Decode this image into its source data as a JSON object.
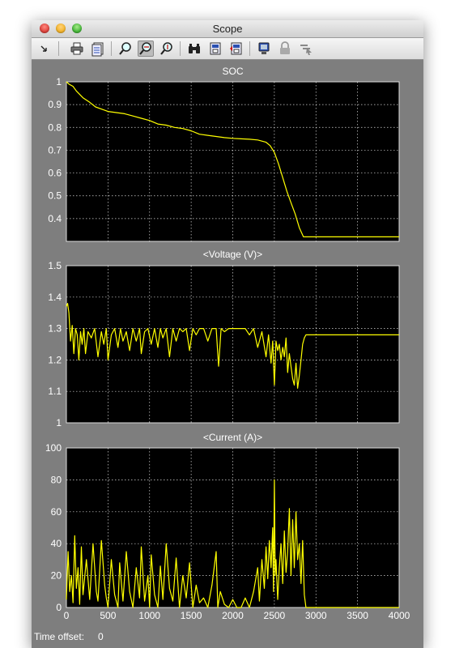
{
  "window": {
    "title": "Scope"
  },
  "toolbar": {
    "icons": [
      "arrow-icon",
      "print-icon",
      "params-icon",
      "zoom-icon",
      "zoom-x-icon",
      "zoom-y-icon",
      "binoculars-icon",
      "save-axes-icon",
      "restore-axes-icon",
      "float-icon",
      "lock-icon",
      "select-signals-icon"
    ]
  },
  "status": {
    "label": "Time offset:",
    "value": "0"
  },
  "colors": {
    "background": "#7e7e7e",
    "axes": "#000000",
    "trace": "#ffff00",
    "grid": "#ffffff"
  },
  "chart_data": [
    {
      "type": "line",
      "title": "SOC",
      "xlim": [
        0,
        4000
      ],
      "ylim": [
        0.3,
        1.0
      ],
      "yticks": [
        "0.4",
        "0.5",
        "0.6",
        "0.7",
        "0.8",
        "0.9",
        "1"
      ],
      "ytick_values": [
        0.4,
        0.5,
        0.6,
        0.7,
        0.8,
        0.9,
        1.0
      ],
      "grid": true,
      "series": [
        {
          "x": [
            0,
            30,
            80,
            120,
            200,
            280,
            350,
            500,
            600,
            700,
            800,
            900,
            1000,
            1100,
            1200,
            1300,
            1400,
            1500,
            1600,
            1700,
            1800,
            1900,
            2000,
            2100,
            2200,
            2300,
            2400,
            2450,
            2500,
            2550,
            2600,
            2650,
            2700,
            2750,
            2800,
            2850,
            3000,
            3500,
            4000
          ],
          "y": [
            1.0,
            0.99,
            0.98,
            0.96,
            0.93,
            0.91,
            0.89,
            0.87,
            0.865,
            0.86,
            0.85,
            0.84,
            0.83,
            0.815,
            0.81,
            0.8,
            0.795,
            0.785,
            0.77,
            0.765,
            0.76,
            0.755,
            0.752,
            0.75,
            0.748,
            0.745,
            0.735,
            0.72,
            0.69,
            0.64,
            0.58,
            0.52,
            0.47,
            0.42,
            0.36,
            0.32,
            0.32,
            0.32,
            0.32
          ]
        }
      ]
    },
    {
      "type": "line",
      "title": "<Voltage (V)>",
      "xlim": [
        0,
        4000
      ],
      "ylim": [
        1.0,
        1.5
      ],
      "yticks": [
        "1",
        "1.1",
        "1.2",
        "1.3",
        "1.4",
        "1.5"
      ],
      "ytick_values": [
        1.0,
        1.1,
        1.2,
        1.3,
        1.4,
        1.5
      ],
      "grid": true,
      "series": [
        {
          "x": [
            0,
            15,
            30,
            50,
            70,
            90,
            110,
            130,
            150,
            170,
            190,
            210,
            230,
            260,
            300,
            340,
            380,
            420,
            450,
            480,
            500,
            540,
            580,
            620,
            650,
            680,
            720,
            760,
            800,
            840,
            880,
            900,
            940,
            980,
            1020,
            1060,
            1100,
            1130,
            1160,
            1200,
            1240,
            1280,
            1320,
            1360,
            1400,
            1440,
            1480,
            1520,
            1560,
            1600,
            1650,
            1700,
            1750,
            1800,
            1830,
            1860,
            1900,
            1950,
            2000,
            2050,
            2100,
            2150,
            2200,
            2250,
            2300,
            2350,
            2400,
            2430,
            2460,
            2480,
            2500,
            2520,
            2540,
            2560,
            2580,
            2600,
            2620,
            2640,
            2660,
            2680,
            2700,
            2720,
            2740,
            2760,
            2780,
            2800,
            2820,
            2840,
            2860,
            2880,
            2900,
            3000,
            3500,
            4000
          ],
          "y": [
            1.37,
            1.38,
            1.35,
            1.26,
            1.31,
            1.22,
            1.3,
            1.28,
            1.2,
            1.29,
            1.25,
            1.3,
            1.22,
            1.29,
            1.27,
            1.3,
            1.21,
            1.29,
            1.25,
            1.3,
            1.2,
            1.28,
            1.3,
            1.24,
            1.3,
            1.26,
            1.29,
            1.23,
            1.3,
            1.26,
            1.3,
            1.22,
            1.29,
            1.3,
            1.25,
            1.3,
            1.24,
            1.3,
            1.27,
            1.3,
            1.21,
            1.3,
            1.26,
            1.3,
            1.29,
            1.3,
            1.23,
            1.3,
            1.28,
            1.3,
            1.3,
            1.26,
            1.3,
            1.3,
            1.18,
            1.3,
            1.29,
            1.3,
            1.3,
            1.3,
            1.3,
            1.3,
            1.28,
            1.3,
            1.24,
            1.29,
            1.21,
            1.28,
            1.19,
            1.26,
            1.12,
            1.26,
            1.23,
            1.25,
            1.2,
            1.24,
            1.21,
            1.27,
            1.16,
            1.22,
            1.18,
            1.14,
            1.12,
            1.19,
            1.11,
            1.15,
            1.2,
            1.25,
            1.27,
            1.28,
            1.28,
            1.28,
            1.28,
            1.28
          ]
        }
      ]
    },
    {
      "type": "line",
      "title": "<Current (A)>",
      "xlim": [
        0,
        4000
      ],
      "ylim": [
        0,
        100
      ],
      "yticks": [
        "0",
        "20",
        "40",
        "60",
        "80",
        "100"
      ],
      "ytick_values": [
        0,
        20,
        40,
        60,
        80,
        100
      ],
      "xticks": [
        "0",
        "500",
        "1000",
        "1500",
        "2000",
        "2500",
        "3000",
        "3500",
        "4000"
      ],
      "xtick_values": [
        0,
        500,
        1000,
        1500,
        2000,
        2500,
        3000,
        3500,
        4000
      ],
      "grid": true,
      "series": [
        {
          "x": [
            0,
            20,
            40,
            60,
            80,
            100,
            120,
            140,
            160,
            180,
            200,
            240,
            280,
            320,
            360,
            380,
            420,
            460,
            480,
            500,
            540,
            580,
            620,
            640,
            680,
            720,
            760,
            800,
            840,
            880,
            900,
            940,
            980,
            1000,
            1020,
            1060,
            1100,
            1130,
            1160,
            1200,
            1240,
            1280,
            1320,
            1360,
            1400,
            1440,
            1480,
            1520,
            1560,
            1600,
            1650,
            1700,
            1750,
            1800,
            1820,
            1850,
            1900,
            1950,
            2000,
            2050,
            2100,
            2150,
            2200,
            2250,
            2300,
            2320,
            2350,
            2380,
            2400,
            2420,
            2440,
            2460,
            2480,
            2490,
            2500,
            2510,
            2520,
            2540,
            2560,
            2580,
            2600,
            2620,
            2640,
            2660,
            2680,
            2700,
            2720,
            2740,
            2760,
            2780,
            2800,
            2820,
            2840,
            2860,
            2880,
            2900,
            3000,
            3500,
            4000
          ],
          "y": [
            5,
            35,
            10,
            20,
            3,
            45,
            12,
            25,
            2,
            38,
            8,
            30,
            5,
            40,
            10,
            4,
            42,
            14,
            6,
            0,
            30,
            8,
            0,
            28,
            4,
            35,
            10,
            0,
            25,
            6,
            38,
            4,
            20,
            0,
            33,
            8,
            0,
            26,
            5,
            40,
            12,
            4,
            31,
            0,
            20,
            6,
            28,
            0,
            14,
            3,
            6,
            0,
            14,
            35,
            0,
            10,
            2,
            0,
            5,
            0,
            0,
            6,
            0,
            10,
            25,
            4,
            30,
            12,
            38,
            18,
            42,
            25,
            50,
            10,
            80,
            20,
            30,
            5,
            25,
            40,
            15,
            48,
            22,
            35,
            62,
            20,
            55,
            25,
            60,
            30,
            40,
            15,
            42,
            8,
            0,
            0,
            0,
            0,
            0
          ]
        }
      ]
    }
  ]
}
